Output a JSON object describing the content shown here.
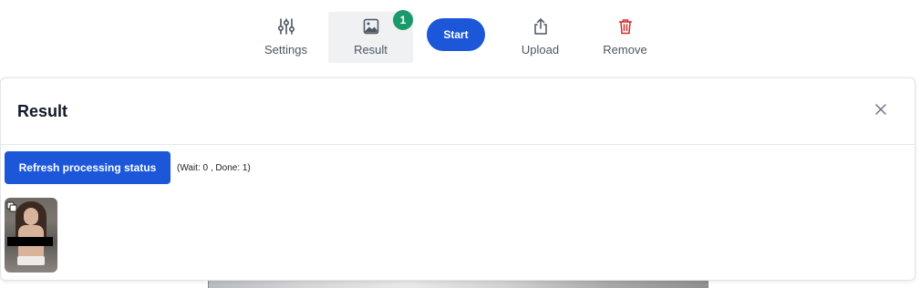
{
  "toolbar": {
    "settings_label": "Settings",
    "result_label": "Result",
    "result_badge": "1",
    "start_label": "Start",
    "upload_label": "Upload",
    "remove_label": "Remove"
  },
  "panel": {
    "title": "Result",
    "refresh_label": "Refresh processing status",
    "status_text": "(Wait: 0 , Done: 1)"
  },
  "colors": {
    "primary": "#1b57d8",
    "badge": "#1a9a6a",
    "remove_icon": "#d12b2b"
  },
  "icons": [
    "sliders-icon",
    "image-icon",
    "upload-icon",
    "trash-icon",
    "close-icon",
    "copy-icon"
  ]
}
